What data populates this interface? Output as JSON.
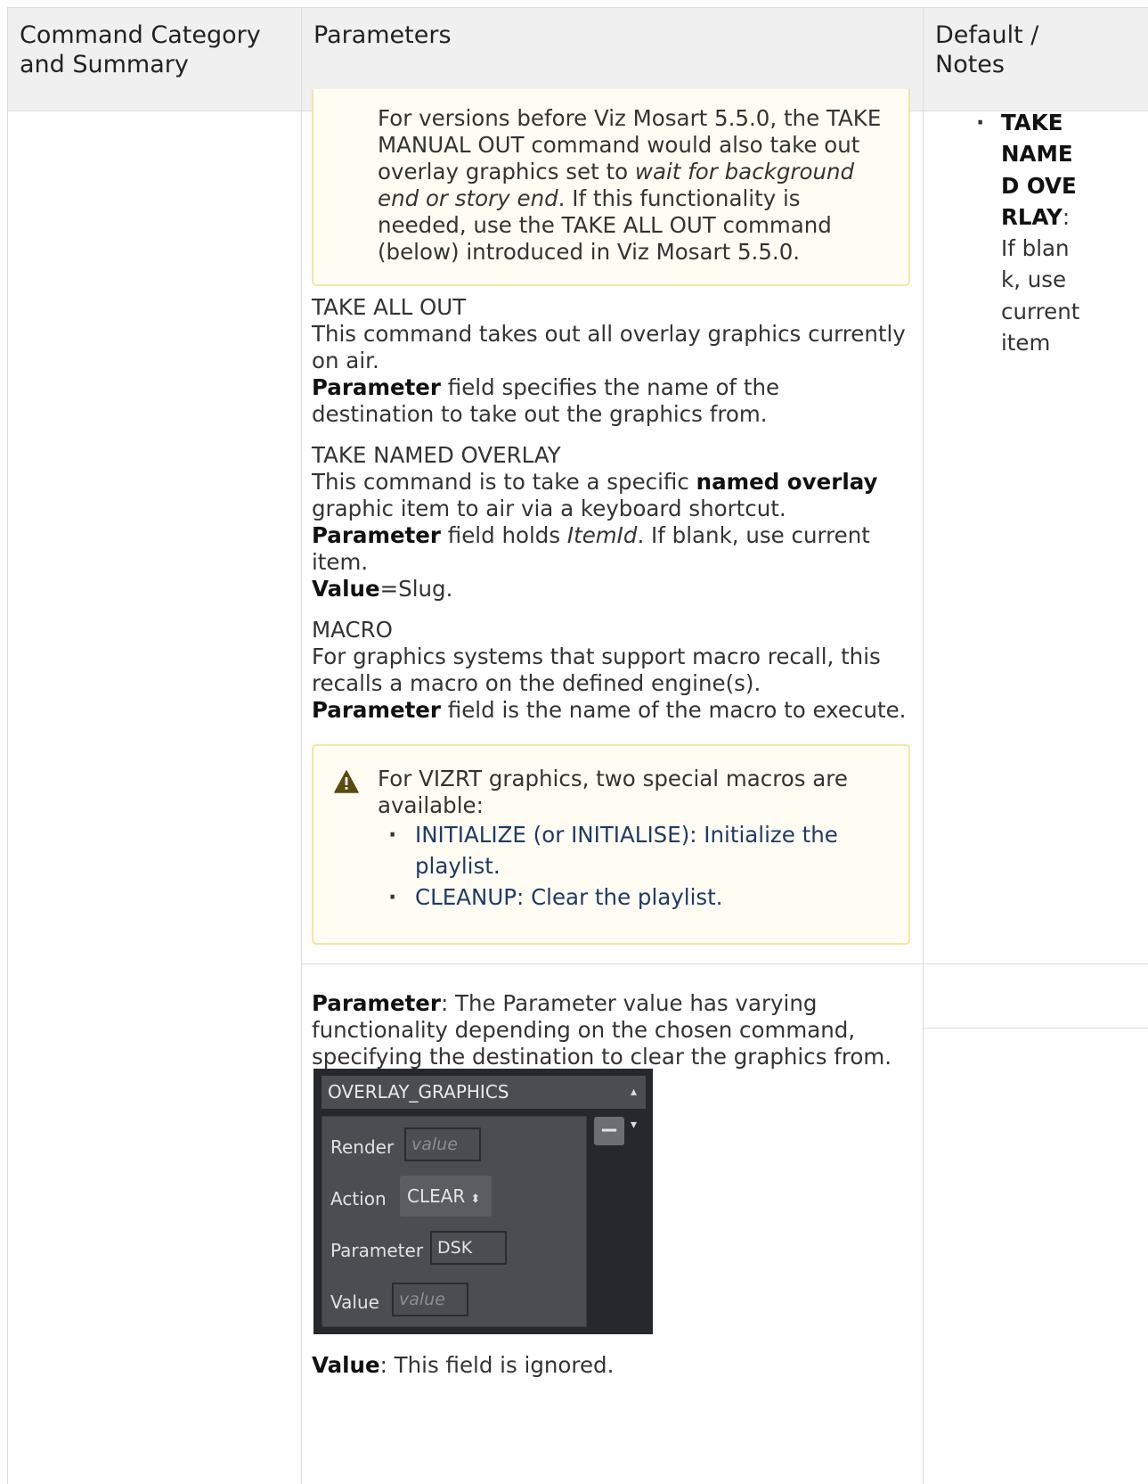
{
  "table": {
    "headers": [
      "Command Category and Summary",
      "Parameters",
      "Default / Notes"
    ]
  },
  "note1": {
    "text_part1": "For versions before Viz Mosart 5.5.0, the TAKE MANUAL OUT command would also take out overlay graphics set to ",
    "text_italic": "wait for background end or story end",
    "text_part2": ". If this functionality is needed, use the TAKE ALL OUT command (below) introduced in Viz Mosart 5.5.0."
  },
  "take_all_out": {
    "title": "TAKE ALL OUT",
    "line1": "This command takes out all overlay graphics currently on air.",
    "param_bold": "Parameter",
    "param_rest": " field specifies the name of the destination to take out the graphics from."
  },
  "take_named_overlay": {
    "title": "TAKE NAMED OVERLAY",
    "line1_a": "This command is to take a specific ",
    "line1_bold": "named overlay",
    "line1_b": " graphic item to air via a keyboard shortcut.",
    "param_bold": "Parameter",
    "param_a": " field holds ",
    "param_italic": "ItemId",
    "param_b": ". If blank, use current item.",
    "value_bold": "Value",
    "value_rest": "=Slug."
  },
  "macro": {
    "title": "MACRO",
    "line1": "For graphics systems that support macro recall, this recalls a macro on the defined engine(s).",
    "param_bold": "Parameter",
    "param_rest": " field is the name of the macro to execute."
  },
  "note2": {
    "intro": "For VIZRT graphics, two special macros are available:",
    "items": [
      "INITIALIZE (or INITIALISE): Initialize the playlist.",
      "CLEANUP: Clear the playlist."
    ]
  },
  "row2": {
    "param_bold": "Parameter",
    "param_rest": ": The Parameter value has varying functionality depending on the chosen command, specifying the destination to clear the graphics from.",
    "value_bold": "Value",
    "value_rest": ": This field is ignored."
  },
  "notes_col": {
    "bold": "TAKE NAMED OVERLAY",
    "rest": ": If blank, use current item"
  },
  "screenshot": {
    "dropdown": "OVERLAY_GRAPHICS",
    "render_label": "Render",
    "render_placeholder": "value",
    "action_label": "Action",
    "action_value": "CLEAR",
    "parameter_label": "Parameter",
    "parameter_value": "DSK",
    "value_label": "Value",
    "value_placeholder": "value",
    "minus": "−"
  }
}
